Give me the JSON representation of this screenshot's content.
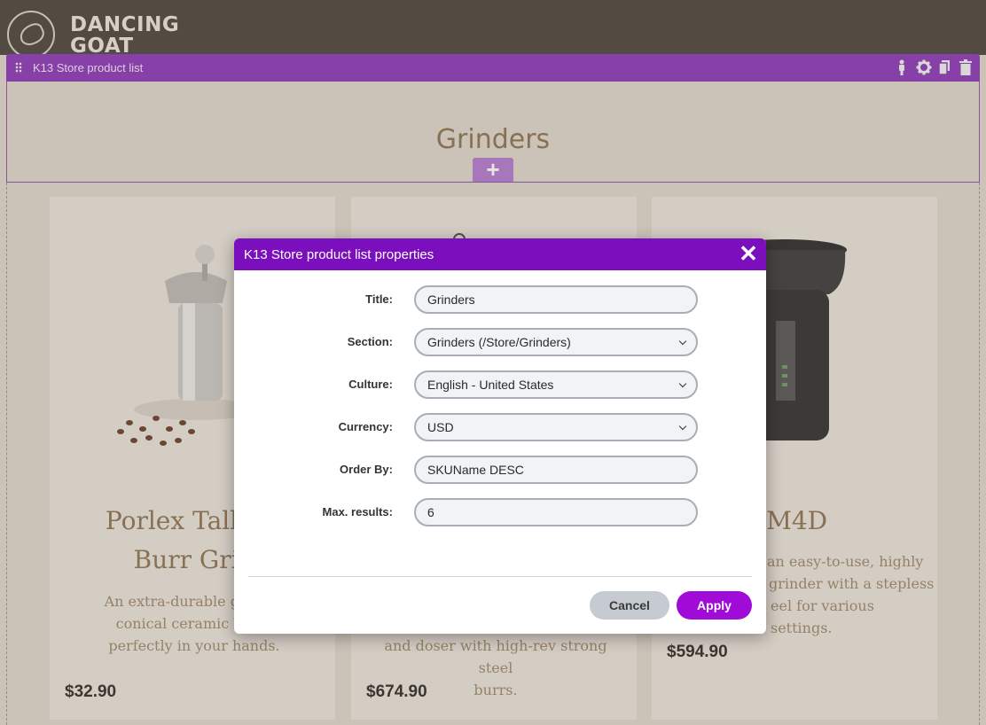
{
  "header": {
    "logo_line1": "DANCING",
    "logo_line2": "GOAT"
  },
  "widget_bar": {
    "title": "K13 Store product list",
    "icons": [
      "drag-handle-icon",
      "personalize-icon",
      "gear-icon",
      "copy-icon",
      "trash-icon"
    ]
  },
  "section": {
    "title": "Grinders",
    "add_label": "+"
  },
  "products": [
    {
      "name_line1": "Porlex Tall Ce",
      "name_line2": "Burr Grinc",
      "desc_lines": [
        "An extra-durable grinder",
        "conical ceramic burrs",
        "perfectly in your hands."
      ],
      "price": "$32.90"
    },
    {
      "desc_lines": [
        "and doser with high-rev strong steel",
        "burrs."
      ],
      "price": "$674.90"
    },
    {
      "name_line1": "cap M4D",
      "desc_lines": [
        "an easy-to-use, highly",
        "grinder with a stepless",
        "eel for various settings."
      ],
      "price": "$594.90"
    }
  ],
  "modal": {
    "title": "K13 Store product list properties",
    "close_label": "✕",
    "fields": {
      "title": {
        "label": "Title:",
        "value": "Grinders"
      },
      "section": {
        "label": "Section:",
        "value": "Grinders (/Store/Grinders)"
      },
      "culture": {
        "label": "Culture:",
        "value": "English - United States"
      },
      "currency": {
        "label": "Currency:",
        "value": "USD"
      },
      "order_by": {
        "label": "Order By:",
        "value": "SKUName DESC"
      },
      "max_results": {
        "label": "Max. results:",
        "value": "6"
      }
    },
    "cancel_label": "Cancel",
    "apply_label": "Apply"
  },
  "colors": {
    "header_bg": "#4a443b",
    "widget_bar": "#8a36b8",
    "modal_header": "#7b0fbd",
    "apply_button": "#a10bd8",
    "cancel_button": "#c6cad1",
    "brand_text": "#8c7152"
  }
}
